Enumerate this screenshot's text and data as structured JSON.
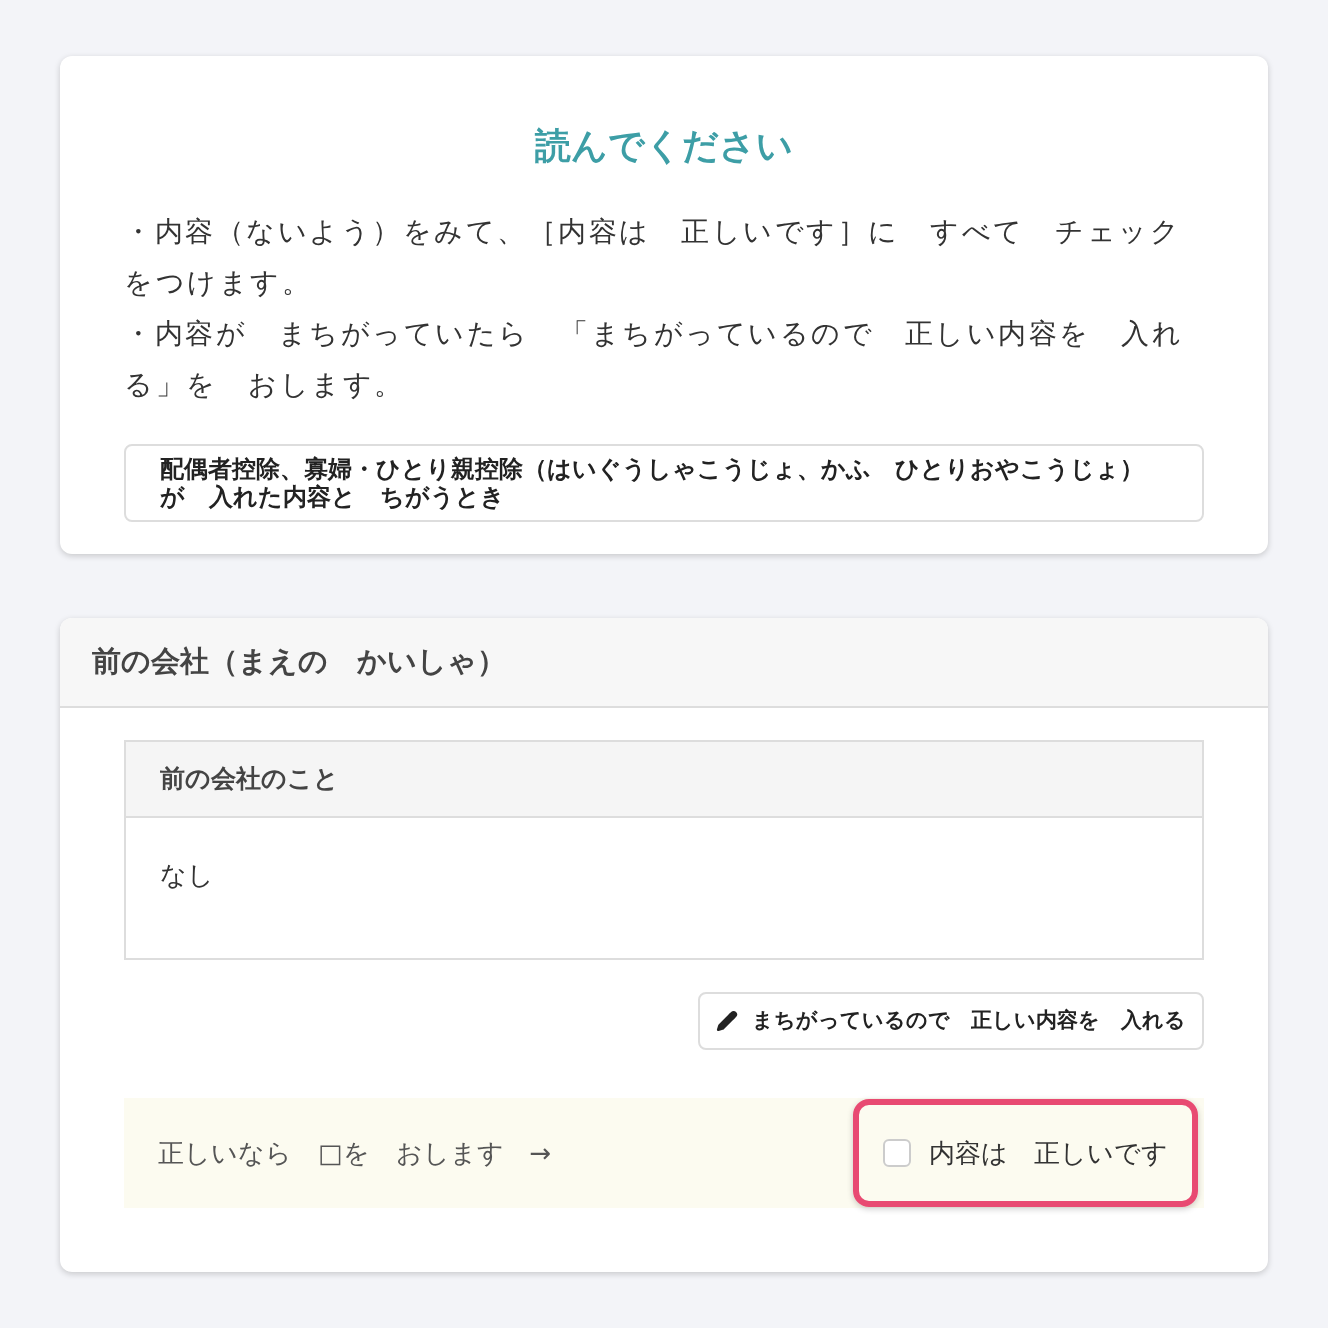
{
  "notice_card": {
    "title": "読んでください",
    "instructions": [
      "・内容（ないよう）をみて、［内容は　正しいです］に　すべて　チェックをつけます。",
      "・内容が　まちがっていたら　「まちがっているので　正しい内容を　入れる」を　おします。"
    ],
    "notice": "配偶者控除、寡婦・ひとり親控除（はいぐうしゃこうじょ、かふ　ひとりおやこうじょ）が　入れた内容と　ちがうとき"
  },
  "section": {
    "title": "前の会社（まえの　かいしゃ）",
    "table": {
      "header": "前の会社のこと",
      "value": "なし"
    },
    "edit_button": "まちがっているので　正しい内容を　入れる",
    "confirm": {
      "hint": "正しいなら　□を　おします　→",
      "label": "内容は　正しいです",
      "checked": false
    }
  }
}
